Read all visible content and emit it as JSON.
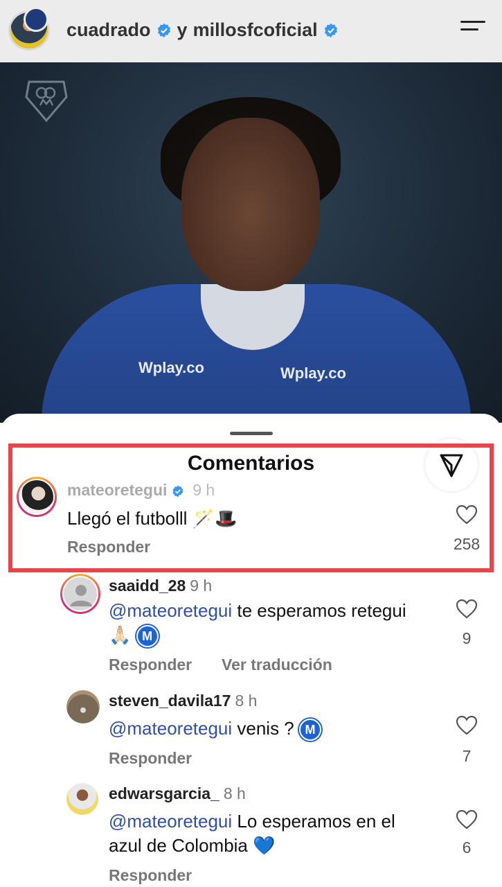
{
  "header": {
    "user1": "cuadrado",
    "connector": "y",
    "user2": "millosfcoficial"
  },
  "hero": {
    "sponsor_left": "Wplay.co",
    "sponsor_right": "Wplay.co"
  },
  "sheet": {
    "title": "Comentarios"
  },
  "comments": [
    {
      "username": "mateoretegui",
      "verified": true,
      "time": "9 h",
      "text": "Llegó el futbolll 🪄🎩",
      "reply_label": "Responder",
      "likes": "258"
    },
    {
      "username": "saaidd_28",
      "time": "9 h",
      "mention": "@mateoretegui",
      "text": " te esperamos retegui 🙏🏻",
      "badge": "M",
      "reply_label": "Responder",
      "translate_label": "Ver traducción",
      "likes": "9"
    },
    {
      "username": "steven_davila17",
      "time": "8 h",
      "mention": "@mateoretegui",
      "text": " venis ?",
      "badge": "M",
      "reply_label": "Responder",
      "likes": "7"
    },
    {
      "username": "edwarsgarcia_",
      "time": "8 h",
      "mention": "@mateoretegui",
      "text": " Lo esperamos en el azul de Colombia 💙",
      "reply_label": "Responder",
      "likes": "6"
    }
  ],
  "colors": {
    "mention": "#2f4fa8",
    "highlight": "#e8454b",
    "verified": "#3897f0",
    "badge": "#1e63d6"
  }
}
